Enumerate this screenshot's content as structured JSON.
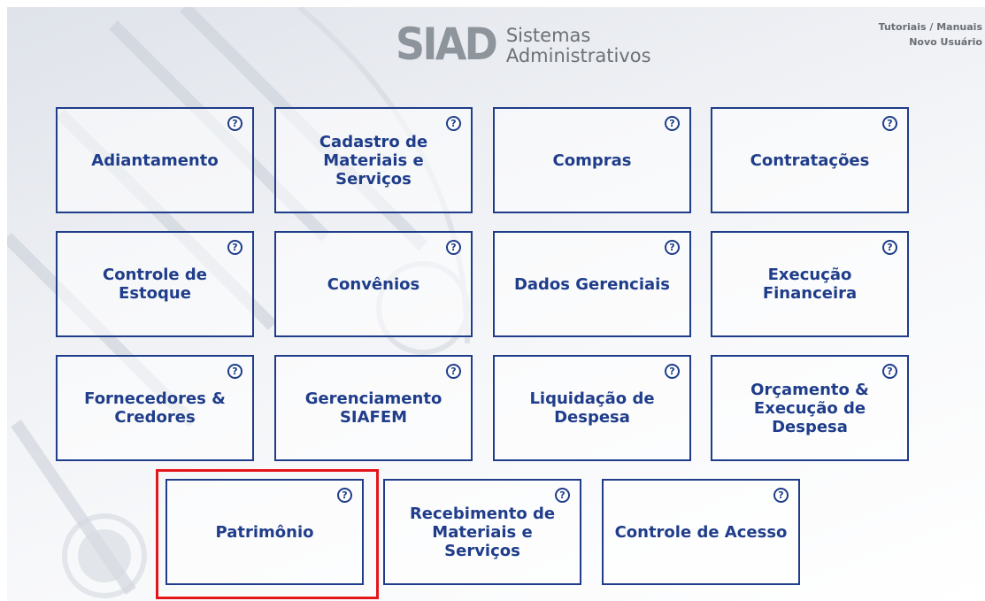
{
  "header": {
    "logo_mark": "SIAD",
    "logo_line1": "Sistemas",
    "logo_line2": "Administrativos",
    "links": [
      "Tutoriais / Manuais",
      "Novo Usuário"
    ]
  },
  "help_symbol": "?",
  "modules": [
    {
      "label": "Adiantamento"
    },
    {
      "label": "Cadastro de\nMateriais e Serviços"
    },
    {
      "label": "Compras"
    },
    {
      "label": "Contratações"
    },
    {
      "label": "Controle de Estoque"
    },
    {
      "label": "Convênios"
    },
    {
      "label": "Dados Gerenciais"
    },
    {
      "label": "Execução Financeira"
    },
    {
      "label": "Fornecedores &\nCredores"
    },
    {
      "label": "Gerenciamento\nSIAFEM"
    },
    {
      "label": "Liquidação de\nDespesa"
    },
    {
      "label": "Orçamento &\nExecução de\nDespesa"
    },
    {
      "label": "Patrimônio"
    },
    {
      "label": "Recebimento de\nMateriais e Serviços"
    },
    {
      "label": "Controle de Acesso"
    }
  ],
  "colors": {
    "tile_border": "#1f3d8a",
    "tile_text": "#1f3d8a",
    "highlight": "#e4161c"
  }
}
